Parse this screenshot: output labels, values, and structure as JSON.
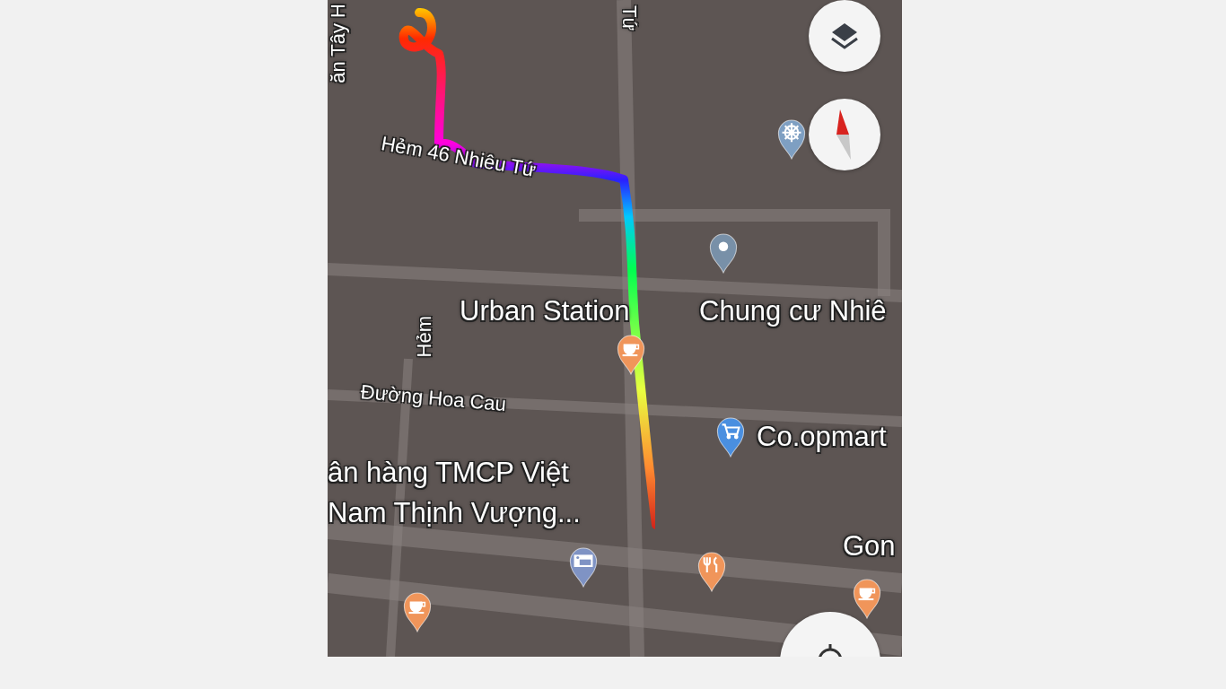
{
  "map": {
    "labels": [
      {
        "kind": "street",
        "text": "ăn Tây H"
      },
      {
        "kind": "street",
        "text": "Tứ"
      },
      {
        "kind": "street",
        "text": "Hẻm 46 Nhiêu Tứ"
      },
      {
        "kind": "place",
        "text": "Urban Station"
      },
      {
        "kind": "place",
        "text": "Chung cư Nhiê"
      },
      {
        "kind": "street",
        "text": "Hẻm"
      },
      {
        "kind": "street",
        "text": "Đường Hoa Cau"
      },
      {
        "kind": "place",
        "text": "Co.opmart"
      },
      {
        "kind": "place",
        "text": "ân hàng TMCP Việt"
      },
      {
        "kind": "place",
        "text": "Nam Thịnh Vượng..."
      },
      {
        "kind": "place",
        "text": "Gon"
      }
    ],
    "pins": [
      {
        "kind": "temple",
        "color": "#7e9fc2"
      },
      {
        "kind": "generic",
        "color": "#7890a8"
      },
      {
        "kind": "coffee",
        "color": "#f0955a"
      },
      {
        "kind": "shopping",
        "color": "#4a8fe0"
      },
      {
        "kind": "atm",
        "color": "#7f93c4"
      },
      {
        "kind": "restaurant",
        "color": "#f0955a"
      },
      {
        "kind": "coffee",
        "color": "#f0955a"
      },
      {
        "kind": "coffee",
        "color": "#f0955a"
      }
    ],
    "controls": [
      {
        "kind": "layers"
      },
      {
        "kind": "compass"
      },
      {
        "kind": "locate"
      }
    ]
  }
}
